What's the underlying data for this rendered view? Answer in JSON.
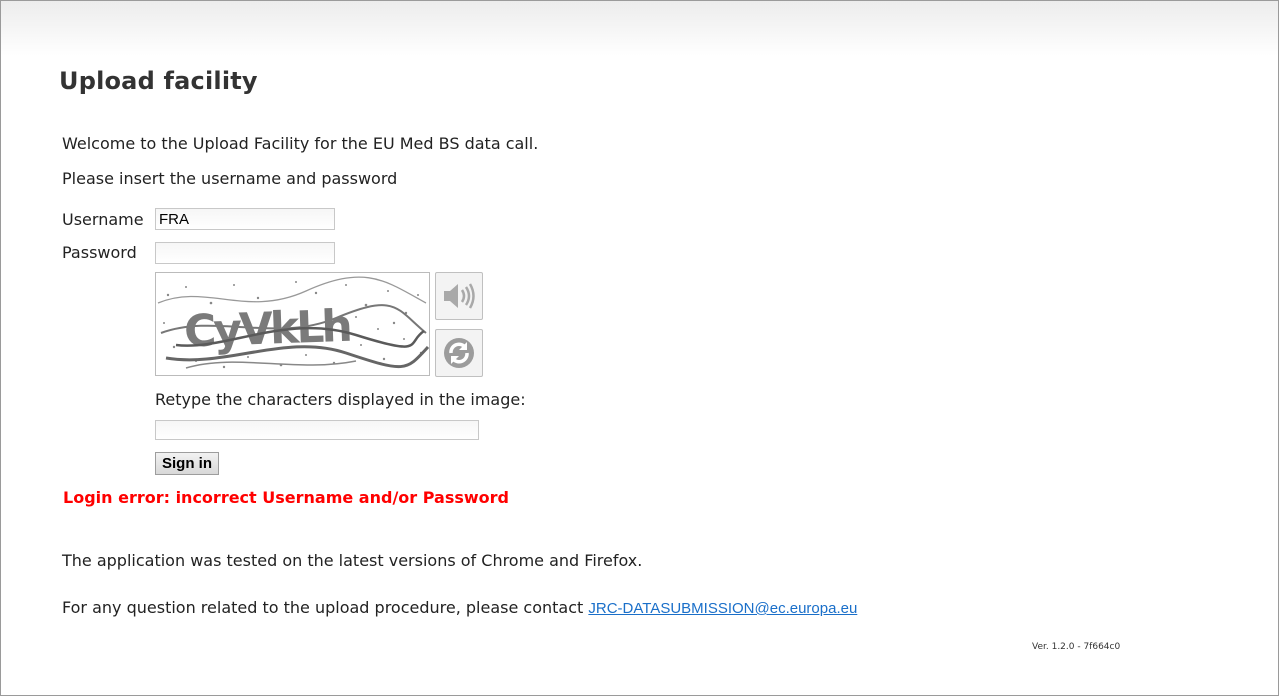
{
  "page": {
    "title": "Upload facility",
    "welcome": "Welcome to the Upload Facility for the EU Med BS data call.",
    "instruction": "Please insert the username and password"
  },
  "form": {
    "username_label": "Username",
    "username_value": "FRA",
    "password_label": "Password",
    "password_value": "",
    "captcha_text": "CyVkLh",
    "audio_icon": "speaker-icon",
    "refresh_icon": "refresh-icon",
    "retype_label": "Retype the characters displayed in the image:",
    "captcha_value": "",
    "signin_label": "Sign in"
  },
  "error": {
    "message": "Login error: incorrect Username and/or Password",
    "color": "#ff0000"
  },
  "footer": {
    "tested_note": "The application was tested on the latest versions of Chrome and Firefox.",
    "contact_prefix": "For any question related to the upload procedure, please contact ",
    "contact_email": "JRC-DATASUBMISSION@ec.europa.eu",
    "link_color": "#1a6fc9",
    "version": "Ver. 1.2.0 - 7f664c0"
  }
}
